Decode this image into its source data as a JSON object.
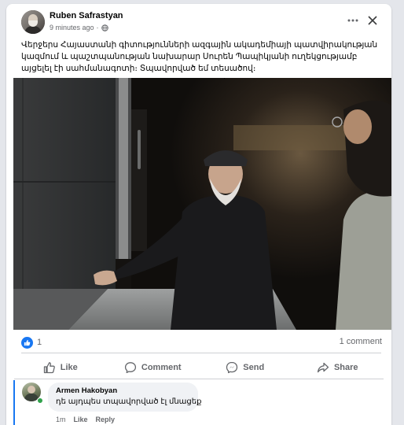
{
  "post": {
    "author": "Ruben Safrastyan",
    "time": "9 minutes ago",
    "separator": "·",
    "privacy_icon": "globe-icon",
    "text": "Վերջերս Հայաստանի գիտությունների ազգային ակադեմիայի պատվիրակության կազմում և պաշտպանության նախարար Սուրեն Պապիկյանի ուղեկցությամբ այցելել էի սահմանագոտի։ Տպավորված եմ տեսածով։",
    "reaction_count": "1",
    "comment_count": "1 comment"
  },
  "actions": {
    "like": "Like",
    "comment": "Comment",
    "send": "Send",
    "share": "Share"
  },
  "comment": {
    "author": "Armen Hakobyan",
    "text": "դե այդպես տպավորված էլ մնացեք",
    "time": "1m",
    "like": "Like",
    "reply": "Reply"
  },
  "colors": {
    "accent": "#1877f2",
    "online": "#31a24c",
    "muted_text": "#65676b"
  }
}
